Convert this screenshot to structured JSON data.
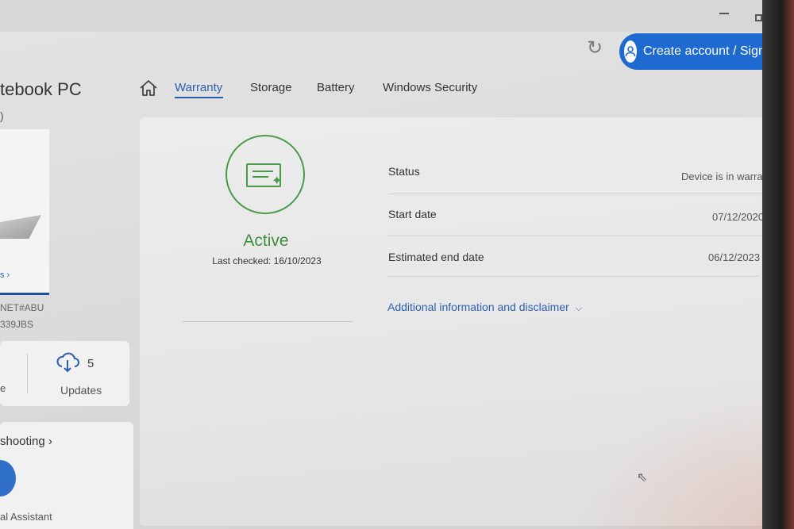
{
  "header": {
    "signin_label": "Create account / Sign in"
  },
  "device": {
    "title_partial": "tebook PC",
    "subtitle_partial": ")",
    "link_partial": "s ›",
    "serial_line1_partial": "NET#ABU",
    "serial_line2_partial": "339JBS"
  },
  "tiles": {
    "left_cut_label": "e",
    "updates_count": "5",
    "updates_label": "Updates",
    "troubleshooting_partial": "shooting ›",
    "assistant_partial": "al Assistant"
  },
  "tabs": [
    {
      "label": "Warranty",
      "active": true
    },
    {
      "label": "Storage",
      "active": false
    },
    {
      "label": "Battery",
      "active": false
    },
    {
      "label": "Windows Security",
      "active": false
    }
  ],
  "warranty": {
    "state": "Active",
    "last_checked": "Last checked: 16/10/2023",
    "rows": [
      {
        "label": "Status",
        "value": "Device is in warranty"
      },
      {
        "label": "Start date",
        "value": "07/12/2020"
      },
      {
        "label": "Estimated end date",
        "value": "06/12/2023"
      }
    ],
    "disclaimer_label": "Additional information and disclaimer"
  },
  "colors": {
    "accent_blue": "#1f6ad0",
    "active_green": "#3f8f3f"
  }
}
